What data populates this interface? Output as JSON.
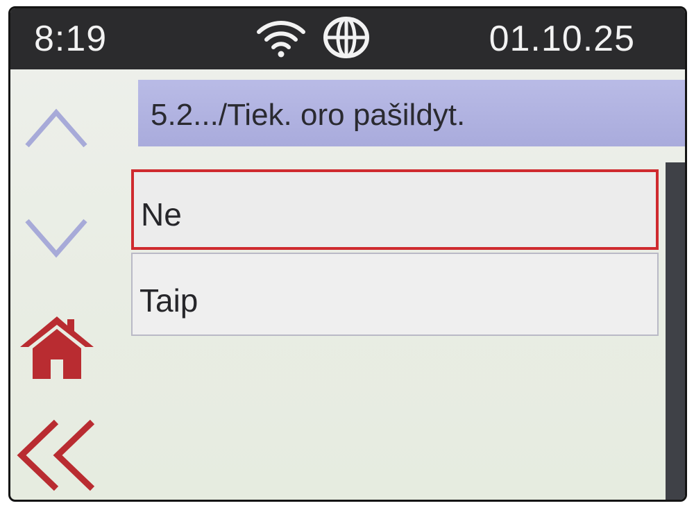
{
  "status_bar": {
    "time": "8:19",
    "date": "01.10.25",
    "icons": [
      "wifi-icon",
      "globe-icon"
    ]
  },
  "navigation": {
    "buttons": [
      "chevron-up-icon",
      "chevron-down-icon",
      "home-icon",
      "double-chevron-left-icon"
    ]
  },
  "menu": {
    "title": "5.2.../Tiek. oro pašildyt.",
    "options": [
      {
        "label": "Ne",
        "selected": true
      },
      {
        "label": "Taip",
        "selected": false
      }
    ]
  },
  "colors": {
    "status_bar_bg": "#2b2b2d",
    "title_bar_bg": "#b0b2e0",
    "selection_border": "#cf2a2f",
    "nav_arrow": "#a7aad8",
    "home_and_back": "#b92c31",
    "scrollbar": "#3f4147"
  }
}
